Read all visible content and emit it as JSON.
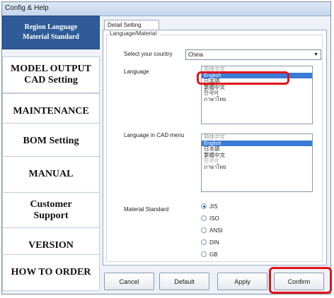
{
  "window": {
    "title": "Config & Help"
  },
  "sidebar": {
    "header_line1": "Region Language",
    "header_line2": "Material Standard",
    "items": [
      {
        "label": "MODEL OUTPUT"
      },
      {
        "label": "CAD Setting"
      },
      {
        "label": "MAINTENANCE"
      },
      {
        "label": "BOM Setting"
      },
      {
        "label": "MANUAL"
      },
      {
        "label": "Customer"
      },
      {
        "label": "Support"
      },
      {
        "label": "VERSION"
      },
      {
        "label": "HOW TO ORDER"
      }
    ]
  },
  "panel": {
    "tab_label": "Detail Setting",
    "group_label": "Language/Material",
    "country_label": "Select your country",
    "country_value": "China",
    "language_label": "Language",
    "language_items": [
      "简体中文",
      "English",
      "日本語",
      "繁體中文",
      "한국어",
      "ภาษาไทย"
    ],
    "language_selected": "English",
    "cad_label": "Language in CAD menu",
    "cad_items": [
      "简体中文",
      "English",
      "日本語",
      "繁體中文",
      "한국어",
      "ภาษาไทย"
    ],
    "cad_selected": "English",
    "material_label": "Material Standard",
    "material_options": [
      "JIS",
      "ISO",
      "ANSI",
      "DIN",
      "GB"
    ],
    "material_selected": "JIS"
  },
  "buttons": {
    "cancel": "Cancel",
    "default": "Default",
    "apply": "Apply",
    "confirm": "Confirm"
  },
  "colors": {
    "sidebar_header": "#2f5c98",
    "highlight": "#e0141a",
    "selection": "#3a7bd5"
  }
}
